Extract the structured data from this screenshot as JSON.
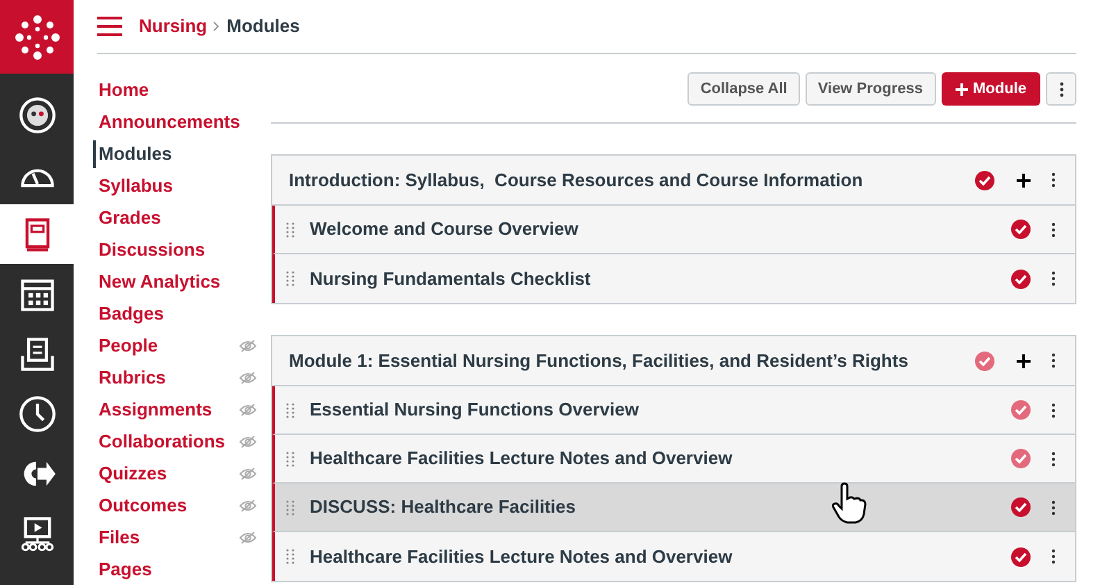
{
  "global_nav": [
    {
      "kind": "account",
      "selected": false
    },
    {
      "kind": "dashboard",
      "selected": false
    },
    {
      "kind": "courses",
      "selected": true
    },
    {
      "kind": "calendar",
      "selected": false
    },
    {
      "kind": "inbox",
      "selected": false
    },
    {
      "kind": "history",
      "selected": false
    },
    {
      "kind": "commons",
      "selected": false
    },
    {
      "kind": "studio",
      "selected": false
    }
  ],
  "breadcrumb": [
    "Nursing",
    "Modules"
  ],
  "course_nav": [
    {
      "label": "Home",
      "selected": false,
      "hidden": false
    },
    {
      "label": "Announcements",
      "selected": false,
      "hidden": false
    },
    {
      "label": "Modules",
      "selected": true,
      "hidden": false
    },
    {
      "label": "Syllabus",
      "selected": false,
      "hidden": false
    },
    {
      "label": "Grades",
      "selected": false,
      "hidden": false
    },
    {
      "label": "Discussions",
      "selected": false,
      "hidden": false
    },
    {
      "label": "New Analytics",
      "selected": false,
      "hidden": false
    },
    {
      "label": "Badges",
      "selected": false,
      "hidden": false
    },
    {
      "label": "People",
      "selected": false,
      "hidden": true
    },
    {
      "label": "Rubrics",
      "selected": false,
      "hidden": true
    },
    {
      "label": "Assignments",
      "selected": false,
      "hidden": true
    },
    {
      "label": "Collaborations",
      "selected": false,
      "hidden": true
    },
    {
      "label": "Quizzes",
      "selected": false,
      "hidden": true
    },
    {
      "label": "Outcomes",
      "selected": false,
      "hidden": true
    },
    {
      "label": "Files",
      "selected": false,
      "hidden": true
    },
    {
      "label": "Pages",
      "selected": false,
      "hidden": false
    }
  ],
  "toolbar": {
    "buttons": [
      {
        "label": "Collapse All",
        "kind": "secondary"
      },
      {
        "label": "View Progress",
        "kind": "secondary"
      },
      {
        "label": "Module",
        "kind": "primary"
      }
    ]
  },
  "modules": [
    {
      "title": "Introduction: Syllabus,  Course Resources and Course Information",
      "published": true,
      "items": [
        {
          "title": "Welcome and Course Overview",
          "published": true,
          "highlighted": false
        },
        {
          "title": "Nursing Fundamentals Checklist",
          "published": true,
          "highlighted": false
        }
      ]
    },
    {
      "title": "Module 1: Essential Nursing Functions, Facilities, and Resident’s Rights",
      "published": false,
      "items": [
        {
          "title": "Essential Nursing Functions Overview",
          "published": false,
          "highlighted": false
        },
        {
          "title": "Healthcare Facilities Lecture Notes and Overview",
          "published": false,
          "highlighted": false
        },
        {
          "title": "DISCUSS: Healthcare Facilities",
          "published": true,
          "highlighted": true
        },
        {
          "title": "Healthcare Facilities Lecture Notes and Overview",
          "published": true,
          "highlighted": false
        }
      ]
    }
  ]
}
